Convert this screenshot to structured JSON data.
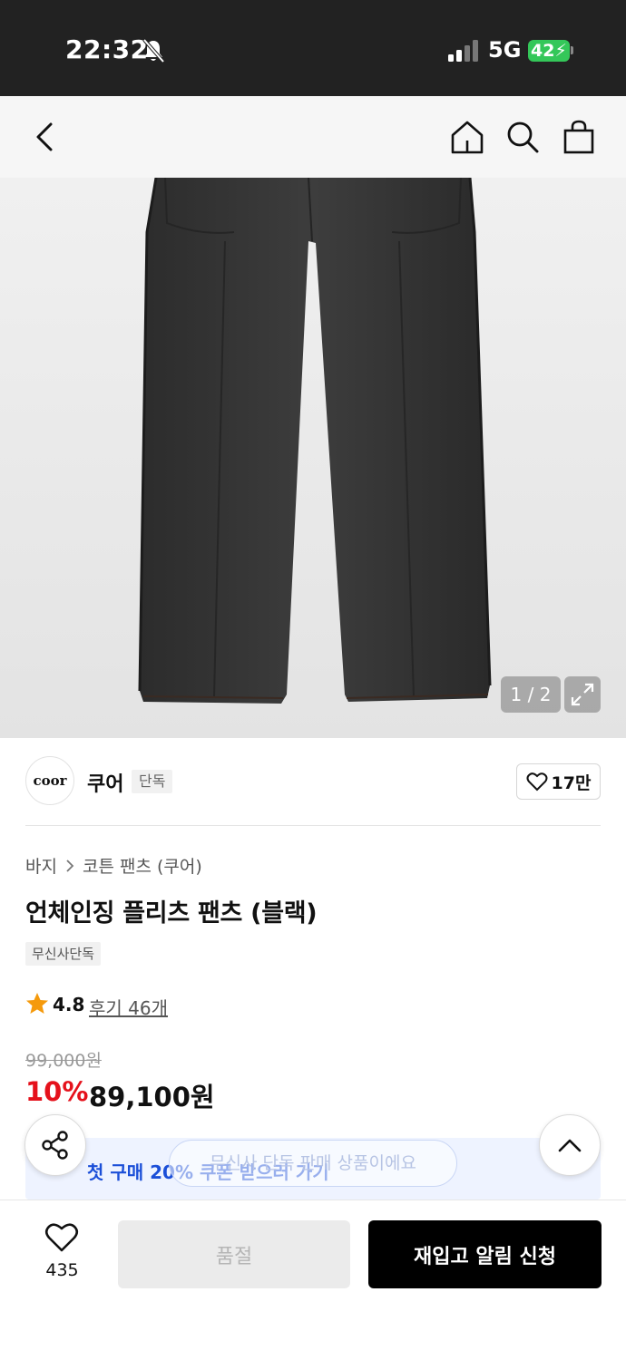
{
  "status_bar": {
    "time": "22:32",
    "network": "5G",
    "battery": "42"
  },
  "top_nav": {
    "icons": [
      "back-icon",
      "home-icon",
      "search-icon",
      "shopping-bag-icon"
    ]
  },
  "gallery": {
    "counter": "1 / 2"
  },
  "brand": {
    "logo_text": "coor",
    "name": "쿠어",
    "tag": "단독",
    "like_count": "17만"
  },
  "breadcrumb": {
    "items": [
      "바지",
      "코튼 팬츠 (쿠어)"
    ]
  },
  "product": {
    "title": "언체인징 플리츠 팬츠 (블랙)",
    "badge": "무신사단독",
    "rating": "4.8",
    "review_link": "후기 46개",
    "original_price": "99,000원",
    "discount_rate": "10%",
    "sale_price": "89,100원"
  },
  "coupon": {
    "text": "첫 구매 20% 쿠폰 받으러 가기",
    "arrow": "›"
  },
  "toast": {
    "text": "무신사 단독 판매 상품이에요"
  },
  "bottom_bar": {
    "wish_count": "435",
    "soldout_label": "품절",
    "restock_label": "재입고 알림 신청"
  },
  "colors": {
    "accent_red": "#e5111b",
    "coupon_blue": "#1b4fd8",
    "battery_green": "#34c759"
  }
}
